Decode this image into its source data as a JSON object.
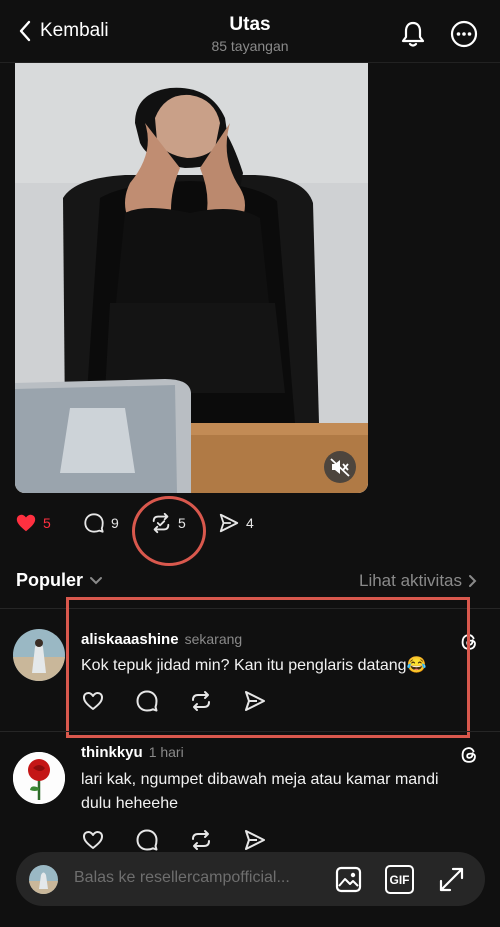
{
  "header": {
    "back_label": "Kembali",
    "title": "Utas",
    "views": "85 tayangan"
  },
  "post": {
    "likes": "5",
    "comments": "9",
    "reposts": "5",
    "shares": "4",
    "colors": {
      "like": "#ff3040",
      "annotation": "#d9584d"
    }
  },
  "sort": {
    "label": "Populer",
    "activity_link": "Lihat aktivitas"
  },
  "comments": [
    {
      "username": "aliskaaashine",
      "time": "sekarang",
      "text": "Kok tepuk jidad min? Kan itu penglaris datang😂"
    },
    {
      "username": "thinkkyu",
      "time": "1 hari",
      "text": "lari kak, ngumpet dibawah meja atau kamar mandi dulu heheehe"
    }
  ],
  "reply": {
    "placeholder": "Balas ke resellercampofficial...",
    "gif_label": "GIF"
  }
}
